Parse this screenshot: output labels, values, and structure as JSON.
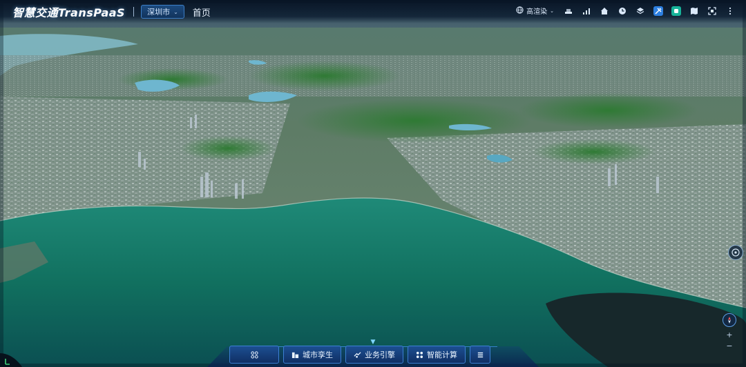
{
  "header": {
    "brand": "智慧交通TransPaaS",
    "city_select": "深圳市",
    "home_link": "首页"
  },
  "toolbar": {
    "render_mode": "高渲染",
    "icons": [
      "globe-icon",
      "layers-stack-icon",
      "bar-signal-icon",
      "home-icon",
      "clock-icon",
      "layers-icon",
      "tools-icon",
      "app-icon",
      "map-icon",
      "fullscreen-icon",
      "more-icon"
    ]
  },
  "dock": {
    "buttons": [
      {
        "label": "",
        "icon": "grid-cluster-icon"
      },
      {
        "label": "城市孪生",
        "icon": "building-icon"
      },
      {
        "label": "业务引擎",
        "icon": "engine-icon"
      },
      {
        "label": "智能计算",
        "icon": "apps-icon"
      },
      {
        "label": "",
        "icon": "menu-icon"
      }
    ]
  },
  "map_controls": {
    "zoom_in": "+",
    "zoom_out": "−"
  },
  "colors": {
    "sea": "#0f6a5e",
    "land": "#3d6a4a",
    "accent": "#2d7fe0",
    "teal": "#17b39a"
  }
}
